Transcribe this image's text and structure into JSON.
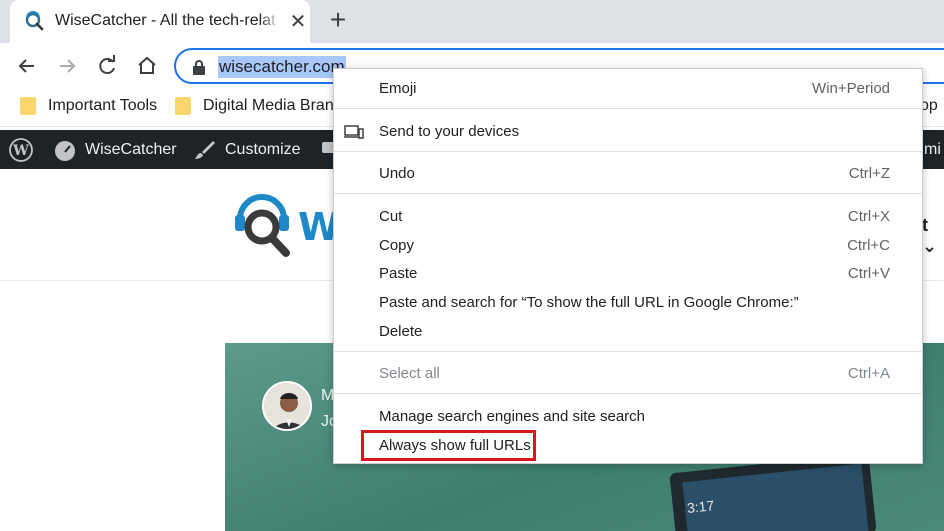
{
  "tab": {
    "title": "WiseCatcher - All the tech-related",
    "close_glyph": "✕",
    "new_tab_glyph": "+"
  },
  "omnibox": {
    "url": "wisecatcher.com"
  },
  "bookmarks": [
    {
      "label": "Important Tools"
    },
    {
      "label": "Digital Media Brands"
    },
    {
      "label": "op"
    }
  ],
  "wp_admin_bar": {
    "site_name": "WiseCatcher",
    "customize": "Customize",
    "right_fragment": "mi"
  },
  "page": {
    "logo_letter": "W",
    "nav_fragment": "t ⌄",
    "author_initial": "M",
    "author_line2": "Jo",
    "device_time": "3:17"
  },
  "context_menu": {
    "items": [
      {
        "label": "Emoji",
        "shortcut": "Win+Period"
      },
      {
        "label": "Send to your devices",
        "shortcut": ""
      },
      {
        "label": "Undo",
        "shortcut": "Ctrl+Z"
      },
      {
        "label": "Cut",
        "shortcut": "Ctrl+X"
      },
      {
        "label": "Copy",
        "shortcut": "Ctrl+C"
      },
      {
        "label": "Paste",
        "shortcut": "Ctrl+V"
      },
      {
        "label": "Paste and search for “To show the full URL in Google Chrome:”",
        "shortcut": ""
      },
      {
        "label": "Delete",
        "shortcut": ""
      },
      {
        "label": "Select all",
        "shortcut": "Ctrl+A"
      },
      {
        "label": "Manage search engines and site search",
        "shortcut": ""
      },
      {
        "label": "Always show full URLs",
        "shortcut": ""
      }
    ]
  },
  "colors": {
    "highlight_box": "#d6181f",
    "accent": "#1a73e8",
    "wp_bar": "#1d2327"
  }
}
